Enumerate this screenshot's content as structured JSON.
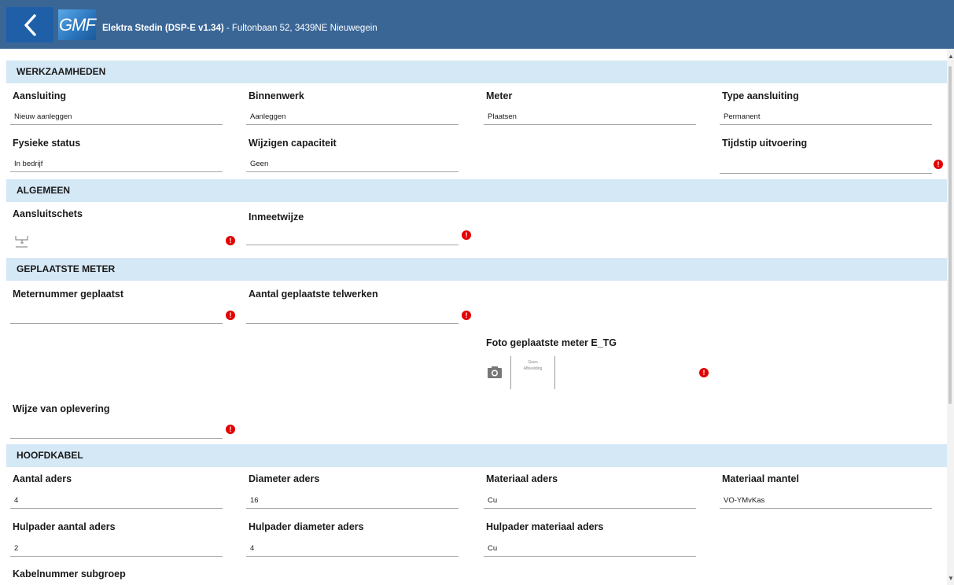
{
  "header": {
    "app_title_bold": "Elektra Stedin (DSP-E v1.34)",
    "app_title_rest": " - Fultonbaan 52, 3439NE Nieuwegein",
    "logo_text": "GMF",
    "back_icon": "chevron-left-icon",
    "color": "#3a6696"
  },
  "sections": {
    "werkzaamheden": "WERKZAAMHEDEN",
    "algemeen": "ALGEMEEN",
    "geplaatste_meter": "GEPLAATSTE METER",
    "hoofdkabel": "HOOFDKABEL"
  },
  "werkzaamheden": {
    "aansluiting": {
      "label": "Aansluiting",
      "value": "Nieuw aanleggen"
    },
    "binnenwerk": {
      "label": "Binnenwerk",
      "value": "Aanleggen"
    },
    "meter": {
      "label": "Meter",
      "value": "Plaatsen"
    },
    "type_aansluiting": {
      "label": "Type aansluiting",
      "value": "Permanent"
    },
    "fysieke_status": {
      "label": "Fysieke status",
      "value": "In bedrijf"
    },
    "wijzigen_capaciteit": {
      "label": "Wijzigen capaciteit",
      "value": "Geen"
    },
    "tijdstip_uitvoering": {
      "label": "Tijdstip uitvoering",
      "value": ""
    }
  },
  "algemeen": {
    "aansluitschets": {
      "label": "Aansluitschets"
    },
    "inmeetwijze": {
      "label": "Inmeetwijze",
      "value": ""
    }
  },
  "geplaatste_meter": {
    "meternummer": {
      "label": "Meternummer geplaatst",
      "value": ""
    },
    "aantal_telwerken": {
      "label": "Aantal geplaatste telwerken",
      "value": ""
    },
    "foto": {
      "label": "Foto geplaatste meter E_TG",
      "placeholder_line1": "Geen",
      "placeholder_line2": "Afbeelding"
    },
    "wijze_oplevering": {
      "label": "Wijze van oplevering",
      "value": ""
    }
  },
  "hoofdkabel": {
    "aantal_aders": {
      "label": "Aantal aders",
      "value": "4"
    },
    "diameter_aders": {
      "label": "Diameter aders",
      "value": "16"
    },
    "materiaal_aders": {
      "label": "Materiaal aders",
      "value": "Cu"
    },
    "materiaal_mantel": {
      "label": "Materiaal mantel",
      "value": "VO-YMvKas"
    },
    "hulpader_aantal": {
      "label": "Hulpader aantal aders",
      "value": "2"
    },
    "hulpader_diameter": {
      "label": "Hulpader diameter aders",
      "value": "4"
    },
    "hulpader_materiaal": {
      "label": "Hulpader materiaal aders",
      "value": "Cu"
    },
    "kabelnummer": {
      "label": "Kabelnummer subgroep"
    }
  },
  "warning_symbol": "!",
  "colors": {
    "section_bg": "#d5e8f6",
    "warning": "#e40000",
    "back_button": "#1f5fa8"
  }
}
